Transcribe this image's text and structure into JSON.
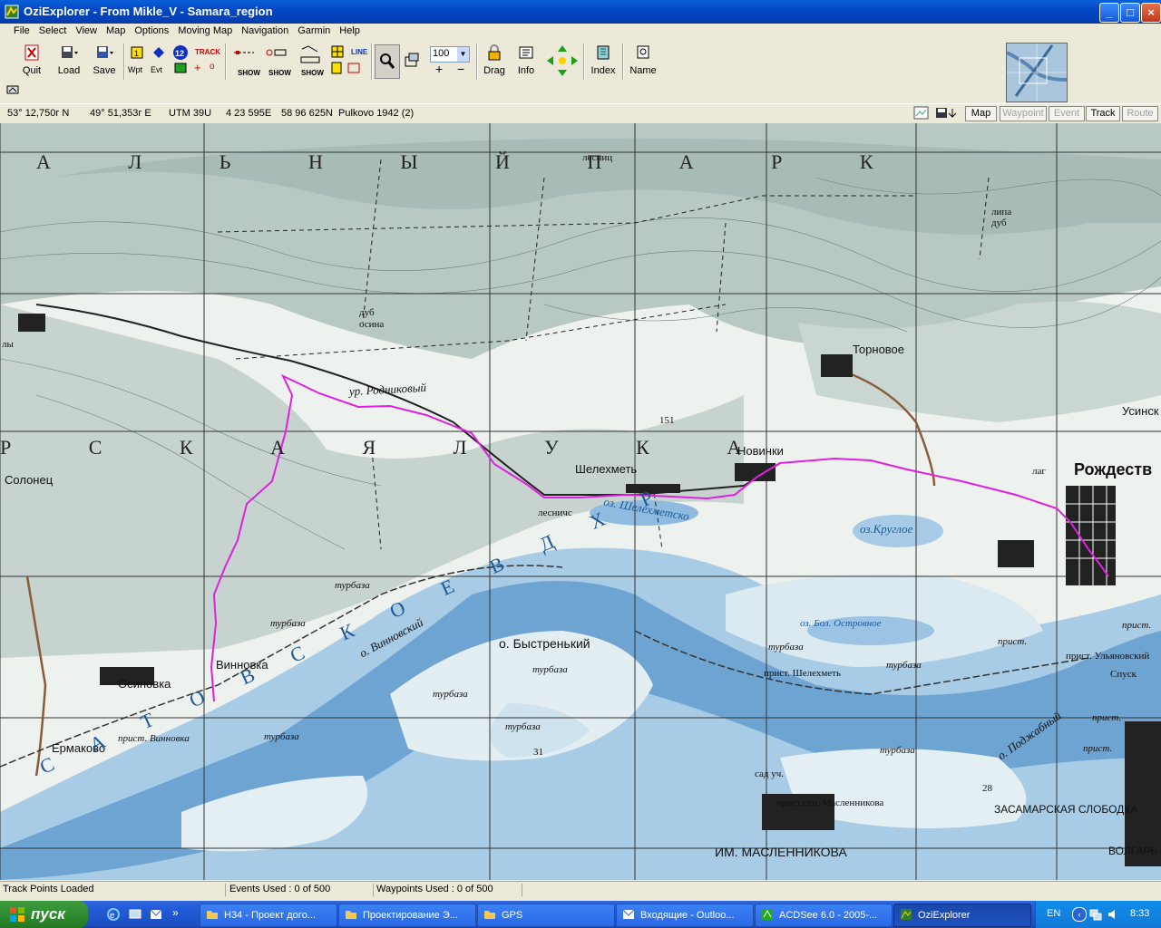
{
  "window": {
    "title": "OziExplorer - From Mikle_V - Samara_region",
    "buttons": {
      "minimize": "_",
      "maximize": "□",
      "close": "×"
    }
  },
  "menu": [
    "File",
    "Select",
    "View",
    "Map",
    "Options",
    "Moving Map",
    "Navigation",
    "Garmin",
    "Help"
  ],
  "toolbar": {
    "quit": "Quit",
    "load": "Load",
    "save": "Save",
    "wpt": "Wpt",
    "evt": "Evt",
    "waypoint_no": "12",
    "track_label": "TRACK",
    "show1": "SHOW",
    "show2": "SHOW",
    "show3": "SHOW",
    "line": "LINE",
    "zoom_value": "100",
    "drag": "Drag",
    "info": "Info",
    "index": "Index",
    "name": "Name"
  },
  "coords": {
    "lat": "53° 12,750г N",
    "lon": "49° 51,353г E",
    "utm": "UTM  39U",
    "easting": "4 23 595E",
    "northing": "58 96 625N",
    "datum": "Pulkovo 1942 (2)"
  },
  "view_tabs": [
    {
      "label": "Map",
      "enabled": true
    },
    {
      "label": "Waypoint",
      "enabled": false
    },
    {
      "label": "Event",
      "enabled": false
    },
    {
      "label": "Track",
      "enabled": true
    },
    {
      "label": "Route",
      "enabled": false
    }
  ],
  "map_labels": {
    "region_top": "А Л Ь Н Ы Й  П А Р К",
    "region_mid": "Р С К А Я  Л У К А",
    "lesnich_top": "лесниц",
    "lipa_dub": "липа\nдуб",
    "dub_osina": "дуб\nосина",
    "ur_rodnikovy": "ур. Родниковый",
    "tornovoe": "Торновое",
    "novinki": "Новинки",
    "shelekhmet": "Шелехметь",
    "rozhdestveno": "Рождеств",
    "usinsk": "Усинск",
    "solonets": "Солонец",
    "lesnich": "лесничс",
    "oz_shelekhmetskoe": "оз. Шелехметско",
    "oz_krugloe": "оз.Круглое",
    "oz_bol_ostrovnoe": "оз. Бол. Островное",
    "turbaza": "турбаза",
    "o_vinnovsky": "о. Винновский",
    "o_bystreny": "о. Быстренький",
    "vinnovka": "Винновка",
    "osinovka": "Осиновка",
    "ermakovo": "Ермаково",
    "prist_vinnovka": "прист. Винновка",
    "prist_shelekhmet": "прист. Шелехметь",
    "prist_ulyanovsky": "прист. Ульяновский",
    "spusk": "Спуск",
    "prist": "прист.",
    "o_podzhabny": "о. Поджабный",
    "zasamarskaya": "ЗАСАМАРСКАЯ СЛОБОДКА",
    "im_maslennikova": "ИМ. МАСЛЕННИКОВА",
    "prist_skhp": "прист.схп. Масленникова",
    "sad": "сад уч.",
    "volgar": "ВОЛГАРЬ",
    "reservoir": "С А Т О В С К О Е  В Д Х Р",
    "lag": "лаг",
    "sp_151": "151",
    "sp_31": "31",
    "sp_28": "28",
    "ly": "лы"
  },
  "status": {
    "track": "Track Points Loaded",
    "events": "Events Used : 0 of 500",
    "waypoints": "Waypoints Used : 0 of 500"
  },
  "taskbar": {
    "start": "пуск",
    "tasks": [
      {
        "label": "Н34 - Проект догo...",
        "active": false
      },
      {
        "label": "Проектирование Э...",
        "active": false
      },
      {
        "label": "GPS",
        "active": false
      },
      {
        "label": "Входящие - Outloo...",
        "active": false
      },
      {
        "label": "ACDSee 6.0 - 2005-...",
        "active": false
      },
      {
        "label": "OziExplorer",
        "active": true
      }
    ],
    "lang": "EN",
    "time": "8:33"
  },
  "colors": {
    "track": "#e020e0",
    "water": "#7fb1d8",
    "forest": "#b7c7c2",
    "grid": "#333333"
  }
}
